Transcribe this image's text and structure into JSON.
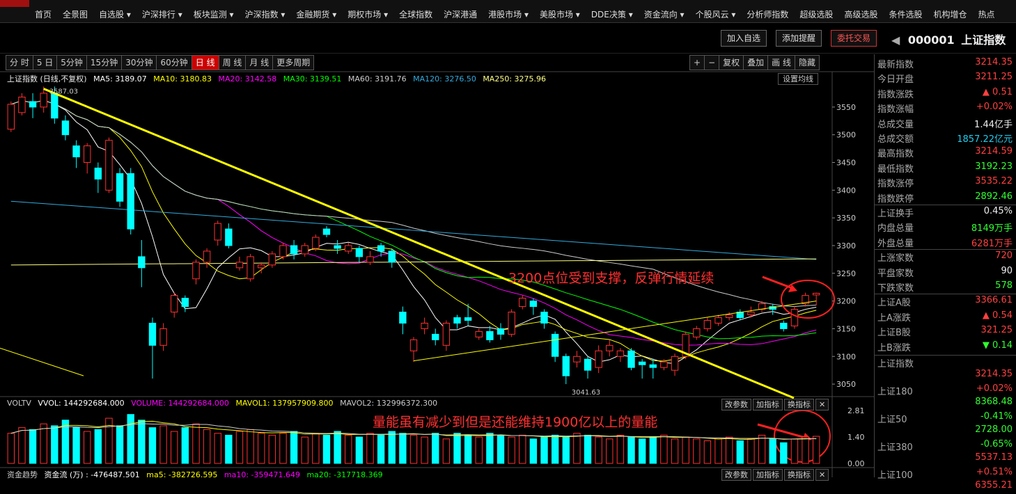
{
  "nav": {
    "items": [
      "首页",
      "全景图",
      "自选股",
      "沪深排行",
      "板块监测",
      "沪深指数",
      "金融期货",
      "期权市场",
      "全球指数",
      "沪深港通",
      "港股市场",
      "美股市场",
      "DDE决策",
      "资金流向",
      "个股风云",
      "分析师指数",
      "超级选股",
      "高级选股",
      "条件选股",
      "机构增仓",
      "热点"
    ],
    "dropdown_flags": [
      false,
      false,
      true,
      true,
      true,
      true,
      true,
      true,
      false,
      false,
      true,
      true,
      true,
      true,
      true,
      false,
      false,
      false,
      false,
      false,
      false
    ]
  },
  "actions": {
    "add_watch": "加入自选",
    "add_alert": "添加提醒",
    "entrust": "委托交易"
  },
  "index_header": {
    "code": "000001",
    "name": "上证指数"
  },
  "periods": [
    "分 时",
    "5 日",
    "5分钟",
    "15分钟",
    "30分钟",
    "60分钟",
    "日 线",
    "周 线",
    "月 线",
    "更多周期"
  ],
  "period_active": "日 线",
  "tools": [
    "+",
    "−",
    "复权",
    "叠加",
    "画 线",
    "隐藏"
  ],
  "ma_legend": {
    "title": "上证指数 (日线,不复权)",
    "ma5": "MA5: 3189.07",
    "ma10": "MA10: 3180.83",
    "ma20": "MA20: 3142.58",
    "ma30": "MA30: 3139.51",
    "ma60": "MA60: 3191.76",
    "ma120": "MA120: 3276.50",
    "ma250": "MA250: 3275.96",
    "setting": "设置均线"
  },
  "vol_legend": {
    "name": "VOLTV",
    "vvol": "VVOL: 144292684.000",
    "volume": "VOLUME: 144292684.000",
    "mavol1": "MAVOL1: 137957909.800",
    "mavol2": "MAVOL2: 132996372.300"
  },
  "flow_legend": {
    "name": "资金趋势",
    "flow": "资金流 (万) : -476487.501",
    "ma5": "ma5: -382726.595",
    "ma10": "ma10: -359471.649",
    "ma20": "ma20: -317718.369"
  },
  "indicator_buttons": {
    "change_params": "改参数",
    "add_indicator": "加指标",
    "switch_indicator": "换指标",
    "close": "✕"
  },
  "annotations": {
    "price": "3200点位受到支撑，反弹行情延续",
    "volume": "量能虽有减少到但是还能维持1900亿以上的量能",
    "high_label": "3587.03",
    "low_label": "3041.63"
  },
  "right_panel": {
    "rows": [
      {
        "label": "最新指数",
        "value": "3214.35",
        "color": "up"
      },
      {
        "label": "今日开盘",
        "value": "3211.25",
        "color": "up"
      },
      {
        "label": "指数涨跌",
        "value": "▲ 0.51",
        "color": "up"
      },
      {
        "label": "指数涨幅",
        "value": "+0.02%",
        "color": "up"
      },
      {
        "label": "总成交量",
        "value": "1.44亿手",
        "color": "wh"
      },
      {
        "label": "总成交额",
        "value": "1857.22亿元",
        "color": "cy"
      },
      {
        "label": "最高指数",
        "value": "3214.59",
        "color": "up"
      },
      {
        "label": "最低指数",
        "value": "3192.23",
        "color": "dn"
      },
      {
        "label": "指数涨停",
        "value": "3535.22",
        "color": "up"
      },
      {
        "label": "指数跌停",
        "value": "2892.46",
        "color": "dn"
      },
      {
        "label": "上证换手",
        "value": "0.45%",
        "color": "wh",
        "sep": true
      },
      {
        "label": "内盘总量",
        "value": "8149万手",
        "color": "dn"
      },
      {
        "label": "外盘总量",
        "value": "6281万手",
        "color": "up"
      },
      {
        "label": "上涨家数",
        "value": "720",
        "color": "up",
        "sep": true
      },
      {
        "label": "平盘家数",
        "value": "90",
        "color": "wh"
      },
      {
        "label": "下跌家数",
        "value": "578",
        "color": "dn"
      },
      {
        "label": "上证A股",
        "value": "3366.61",
        "color": "up",
        "sep": true
      },
      {
        "label": "上A涨跌",
        "value": "▲ 0.54",
        "color": "up"
      },
      {
        "label": "上证B股",
        "value": "321.25",
        "color": "up"
      },
      {
        "label": "上B涨跌",
        "value": "▼ 0.14",
        "color": "dn"
      }
    ],
    "indices": [
      {
        "label": "上证指数",
        "value": "3214.35",
        "pct": "+0.02%",
        "color": "up"
      },
      {
        "label": "上证180",
        "value": "8368.48",
        "pct": "-0.41%",
        "color": "dn"
      },
      {
        "label": "上证50",
        "value": "2728.00",
        "pct": "-0.65%",
        "color": "dn"
      },
      {
        "label": "上证380",
        "value": "5537.13",
        "pct": "+0.51%",
        "color": "up"
      },
      {
        "label": "上证100",
        "value": "6355.21",
        "pct": "",
        "color": "up"
      }
    ]
  },
  "colors": {
    "up": "#ff3030",
    "down": "#00ffff",
    "ma5": "#ffffff",
    "ma10": "#ffff00",
    "ma20": "#ff00ff",
    "ma30": "#00ff00",
    "ma60": "#cccccc",
    "ma120": "#33aadd",
    "ma250": "#ffff80",
    "trend": "#ffff00"
  },
  "chart_data": {
    "type": "candlestick",
    "price_ylim": [
      3030,
      3590
    ],
    "price_ticks": [
      3050,
      3100,
      3150,
      3200,
      3250,
      3300,
      3350,
      3400,
      3450,
      3500,
      3550
    ],
    "candles": [
      [
        3510,
        3555,
        3505,
        3560
      ],
      [
        3540,
        3568,
        3535,
        3575
      ],
      [
        3560,
        3550,
        3530,
        3575
      ],
      [
        3550,
        3575,
        3540,
        3587
      ],
      [
        3575,
        3530,
        3520,
        3587
      ],
      [
        3525,
        3500,
        3490,
        3535
      ],
      [
        3480,
        3460,
        3440,
        3490
      ],
      [
        3450,
        3480,
        3430,
        3485
      ],
      [
        3440,
        3420,
        3395,
        3450
      ],
      [
        3400,
        3490,
        3395,
        3495
      ],
      [
        3430,
        3380,
        3370,
        3440
      ],
      [
        3430,
        3330,
        3320,
        3440
      ],
      [
        3280,
        3260,
        3225,
        3310
      ],
      [
        3160,
        3120,
        3060,
        3170
      ],
      [
        3120,
        3150,
        3110,
        3160
      ],
      [
        3180,
        3210,
        3170,
        3215
      ],
      [
        3205,
        3190,
        3180,
        3210
      ],
      [
        3240,
        3270,
        3230,
        3275
      ],
      [
        3270,
        3290,
        3260,
        3295
      ],
      [
        3310,
        3340,
        3300,
        3345
      ],
      [
        3330,
        3300,
        3295,
        3340
      ],
      [
        3260,
        3270,
        3255,
        3280
      ],
      [
        3240,
        3280,
        3235,
        3285
      ],
      [
        3260,
        3265,
        3250,
        3270
      ],
      [
        3265,
        3285,
        3260,
        3290
      ],
      [
        3280,
        3300,
        3275,
        3305
      ],
      [
        3300,
        3285,
        3275,
        3310
      ],
      [
        3285,
        3300,
        3280,
        3305
      ],
      [
        3295,
        3315,
        3290,
        3320
      ],
      [
        3330,
        3320,
        3315,
        3335
      ],
      [
        3300,
        3295,
        3285,
        3310
      ],
      [
        3290,
        3300,
        3285,
        3305
      ],
      [
        3295,
        3280,
        3270,
        3300
      ],
      [
        3270,
        3280,
        3265,
        3290
      ],
      [
        3300,
        3290,
        3280,
        3305
      ],
      [
        3290,
        3270,
        3260,
        3295
      ],
      [
        3180,
        3160,
        3140,
        3190
      ],
      [
        3110,
        3130,
        3090,
        3135
      ],
      [
        3150,
        3160,
        3140,
        3170
      ],
      [
        3140,
        3130,
        3120,
        3150
      ],
      [
        3120,
        3160,
        3110,
        3165
      ],
      [
        3170,
        3160,
        3150,
        3175
      ],
      [
        3170,
        3165,
        3155,
        3195
      ],
      [
        3135,
        3145,
        3130,
        3150
      ],
      [
        3145,
        3130,
        3125,
        3155
      ],
      [
        3150,
        3140,
        3130,
        3160
      ],
      [
        3140,
        3180,
        3135,
        3185
      ],
      [
        3190,
        3205,
        3185,
        3210
      ],
      [
        3200,
        3190,
        3175,
        3205
      ],
      [
        3180,
        3160,
        3150,
        3185
      ],
      [
        3140,
        3100,
        3090,
        3145
      ],
      [
        3100,
        3065,
        3050,
        3105
      ],
      [
        3090,
        3100,
        3080,
        3110
      ],
      [
        3095,
        3075,
        3060,
        3100
      ],
      [
        3080,
        3110,
        3070,
        3120
      ],
      [
        3110,
        3120,
        3100,
        3130
      ],
      [
        3100,
        3110,
        3090,
        3115
      ],
      [
        3110,
        3080,
        3075,
        3115
      ],
      [
        3090,
        3085,
        3060,
        3095
      ],
      [
        3085,
        3080,
        3060,
        3095
      ],
      [
        3080,
        3090,
        3075,
        3095
      ],
      [
        3075,
        3100,
        3065,
        3105
      ],
      [
        3100,
        3140,
        3095,
        3145
      ],
      [
        3135,
        3150,
        3130,
        3155
      ],
      [
        3150,
        3165,
        3145,
        3170
      ],
      [
        3160,
        3170,
        3155,
        3175
      ],
      [
        3170,
        3175,
        3165,
        3180
      ],
      [
        3180,
        3170,
        3165,
        3185
      ],
      [
        3175,
        3180,
        3170,
        3190
      ],
      [
        3185,
        3195,
        3180,
        3200
      ],
      [
        3190,
        3185,
        3175,
        3195
      ],
      [
        3160,
        3150,
        3145,
        3165
      ],
      [
        3155,
        3185,
        3150,
        3190
      ],
      [
        3195,
        3210,
        3190,
        3215
      ],
      [
        3211,
        3214,
        3192,
        3215
      ]
    ],
    "vol_ylim": [
      0,
      2.81
    ],
    "vol_ticks": [
      "2.81",
      "1.40",
      "0.00"
    ],
    "volumes": [
      1.6,
      1.9,
      1.8,
      2.1,
      2.0,
      2.3,
      1.9,
      1.7,
      1.8,
      2.4,
      2.0,
      2.6,
      2.3,
      1.9,
      2.0,
      1.7,
      1.9,
      2.1,
      1.8,
      1.6,
      1.5,
      1.7,
      1.8,
      1.6,
      1.5,
      1.6,
      1.7,
      1.4,
      1.6,
      1.5,
      1.7,
      1.5,
      1.4,
      1.6,
      1.5,
      1.7,
      1.6,
      1.5,
      1.4,
      1.6,
      1.3,
      1.6,
      1.5,
      1.4,
      1.6,
      1.5,
      1.4,
      1.5,
      1.3,
      1.4,
      1.5,
      1.4,
      1.6,
      1.5,
      1.4,
      1.3,
      1.5,
      1.4,
      1.3,
      1.4,
      1.5,
      1.3,
      1.4,
      1.3,
      1.2,
      1.3,
      1.4,
      1.2,
      1.3,
      1.5,
      1.3,
      1.1,
      1.3,
      1.4,
      1.44
    ],
    "vol_up": [
      true,
      true,
      false,
      true,
      false,
      false,
      false,
      true,
      false,
      true,
      false,
      false,
      false,
      false,
      true,
      true,
      false,
      true,
      true,
      true,
      false,
      true,
      true,
      true,
      true,
      true,
      false,
      true,
      true,
      false,
      false,
      true,
      false,
      true,
      false,
      false,
      false,
      true,
      true,
      false,
      true,
      false,
      false,
      true,
      false,
      false,
      true,
      true,
      false,
      false,
      false,
      false,
      true,
      false,
      true,
      true,
      true,
      false,
      false,
      false,
      true,
      true,
      true,
      true,
      true,
      true,
      true,
      false,
      true,
      true,
      false,
      false,
      true,
      true,
      true
    ]
  }
}
